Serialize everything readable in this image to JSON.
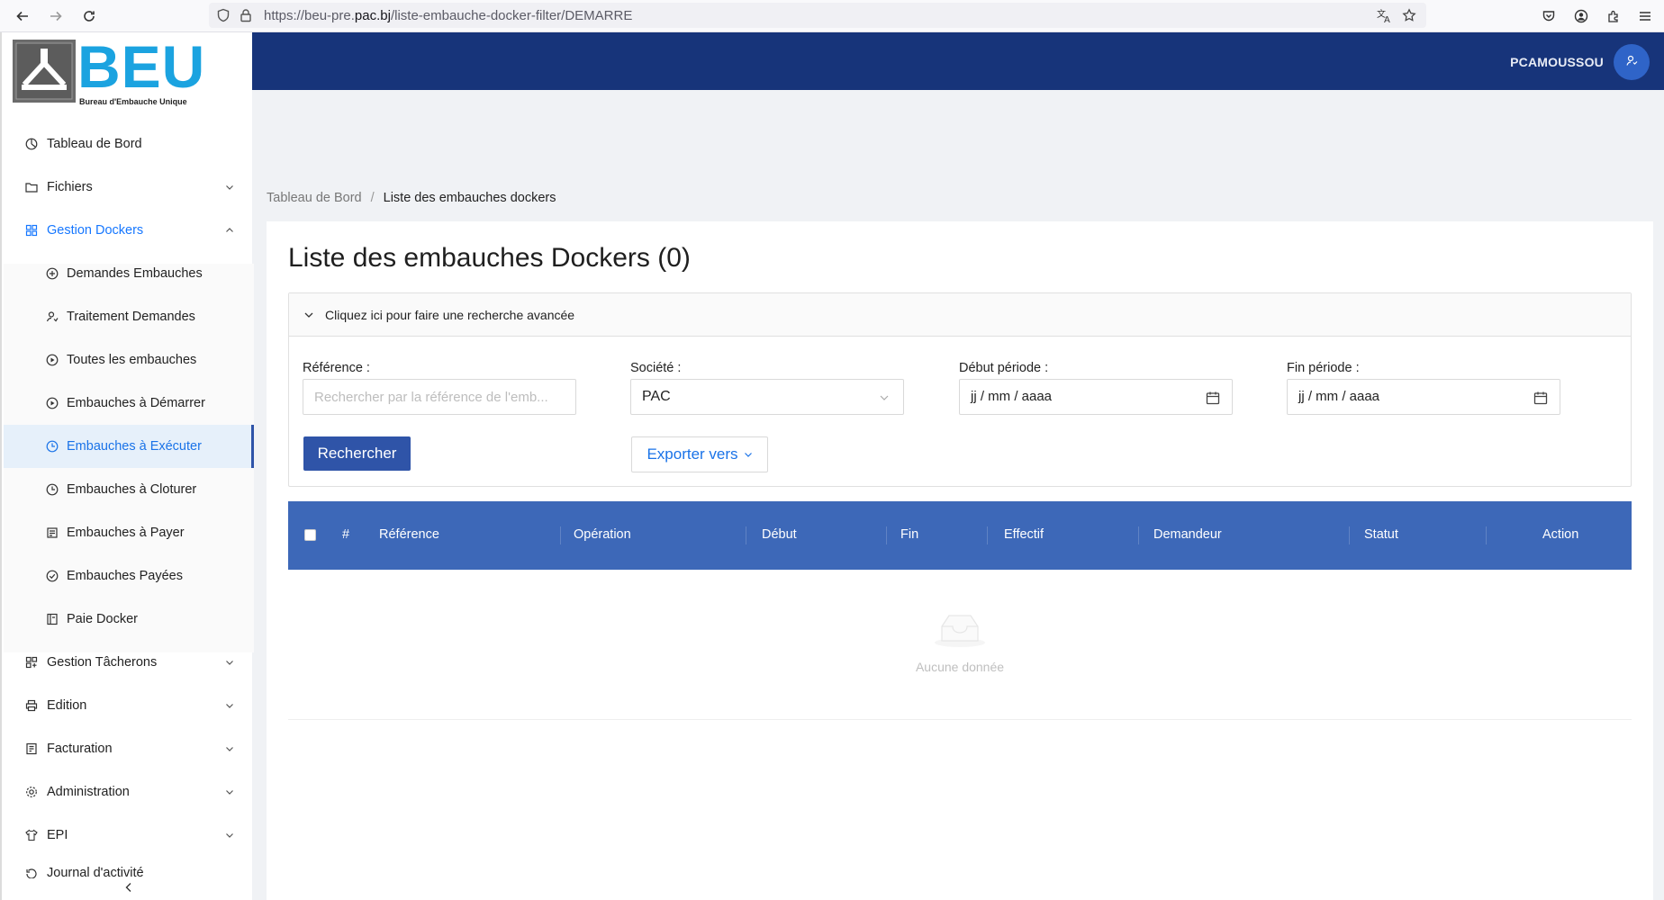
{
  "browser": {
    "url_prefix": "https://beu-pre.",
    "url_host": "pac.bj",
    "url_path": "/liste-embauche-docker-filter/DEMARRE"
  },
  "logo": {
    "text": "BEU",
    "tagline": "Bureau d'Embauche Unique"
  },
  "sidebar": {
    "items": [
      {
        "label": "Tableau de Bord",
        "icon": "dashboard-icon"
      },
      {
        "label": "Fichiers",
        "icon": "folder-icon"
      },
      {
        "label": "Gestion Dockers",
        "icon": "appstore-icon"
      },
      {
        "label": "Demandes Embauches",
        "icon": "plus-circle-icon"
      },
      {
        "label": "Traitement Demandes",
        "icon": "user-switch-icon"
      },
      {
        "label": "Toutes les embauches",
        "icon": "play-circle-icon"
      },
      {
        "label": "Embauches à Démarrer",
        "icon": "play-circle-icon"
      },
      {
        "label": "Embauches à Exécuter",
        "icon": "clock-icon"
      },
      {
        "label": "Embauches à Cloturer",
        "icon": "clock-icon"
      },
      {
        "label": "Embauches à Payer",
        "icon": "bill-icon"
      },
      {
        "label": "Embauches Payées",
        "icon": "check-circle-icon"
      },
      {
        "label": "Paie Docker",
        "icon": "book-icon"
      },
      {
        "label": "Gestion Tâcherons",
        "icon": "team-icon"
      },
      {
        "label": "Edition",
        "icon": "printer-icon"
      },
      {
        "label": "Facturation",
        "icon": "invoice-icon"
      },
      {
        "label": "Administration",
        "icon": "gear-icon"
      },
      {
        "label": "EPI",
        "icon": "shirt-icon"
      },
      {
        "label": "Journal d'activité",
        "icon": "history-icon"
      }
    ]
  },
  "header": {
    "username": "PCAMOUSSOU"
  },
  "breadcrumb": {
    "home": "Tableau de Bord",
    "separator": "/",
    "current": "Liste des embauches dockers"
  },
  "page": {
    "title": "Liste des embauches Dockers (0)"
  },
  "search": {
    "toggle_label": "Cliquez ici pour faire une recherche avancée",
    "reference_label": "Référence",
    "reference_placeholder": "Rechercher par la référence de l'emb...",
    "societe_label": "Société",
    "societe_value": "PAC",
    "debut_label": "Début période",
    "debut_value": "jj / mm / aaaa",
    "fin_label": "Fin période",
    "fin_value": "jj / mm / aaaa",
    "search_button": "Rechercher",
    "export_button": "Exporter vers"
  },
  "table": {
    "columns": [
      "#",
      "Référence",
      "Opération",
      "Début",
      "Fin",
      "Effectif",
      "Demandeur",
      "Statut",
      "Action"
    ],
    "empty_text": "Aucune donnée"
  },
  "colors": {
    "header_bg": "#17347a",
    "table_header_bg": "#3d68b8",
    "primary_button": "#2f54a8",
    "link_blue": "#1a73e8",
    "logo_blue": "#1ba3e0"
  }
}
